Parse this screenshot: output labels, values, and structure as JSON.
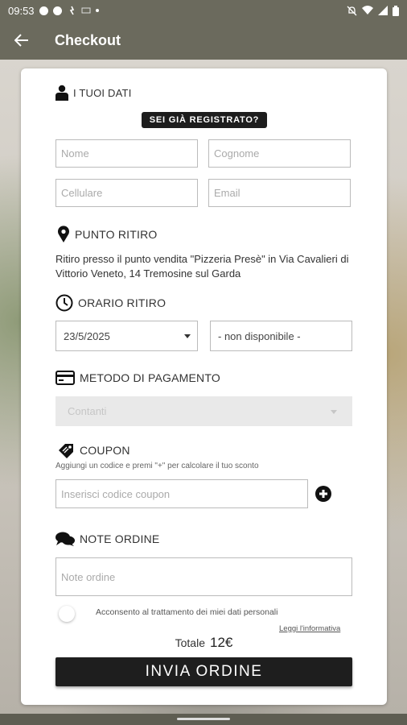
{
  "status_bar": {
    "time": "09:53"
  },
  "app_bar": {
    "title": "Checkout"
  },
  "personal": {
    "title": "I TUOI DATI",
    "registered_badge": "SEI GIÀ REGISTRATO?",
    "first_name_placeholder": "Nome",
    "last_name_placeholder": "Cognome",
    "phone_placeholder": "Cellulare",
    "email_placeholder": "Email"
  },
  "pickup_point": {
    "title": "PUNTO RITIRO",
    "description": "Ritiro presso il punto vendita \"Pizzeria Presè\" in Via Cavalieri di Vittorio Veneto, 14 Tremosine sul Garda"
  },
  "pickup_time": {
    "title": "ORARIO RITIRO",
    "date_value": "23/5/2025",
    "time_value": "- non disponibile -"
  },
  "payment": {
    "title": "METODO DI PAGAMENTO",
    "method_value": "Contanti"
  },
  "coupon": {
    "title": "COUPON",
    "hint": "Aggiungi un codice e premi \"+\" per calcolare il tuo sconto",
    "placeholder": "Inserisci codice coupon"
  },
  "notes": {
    "title": "NOTE ORDINE",
    "placeholder": "Note ordine"
  },
  "consent": {
    "label": "Acconsento al trattamento dei miei dati personali",
    "link": "Leggi l'informativa"
  },
  "total": {
    "label": "Totale",
    "value": "12€"
  },
  "submit": {
    "label": "INVIA ORDINE"
  }
}
